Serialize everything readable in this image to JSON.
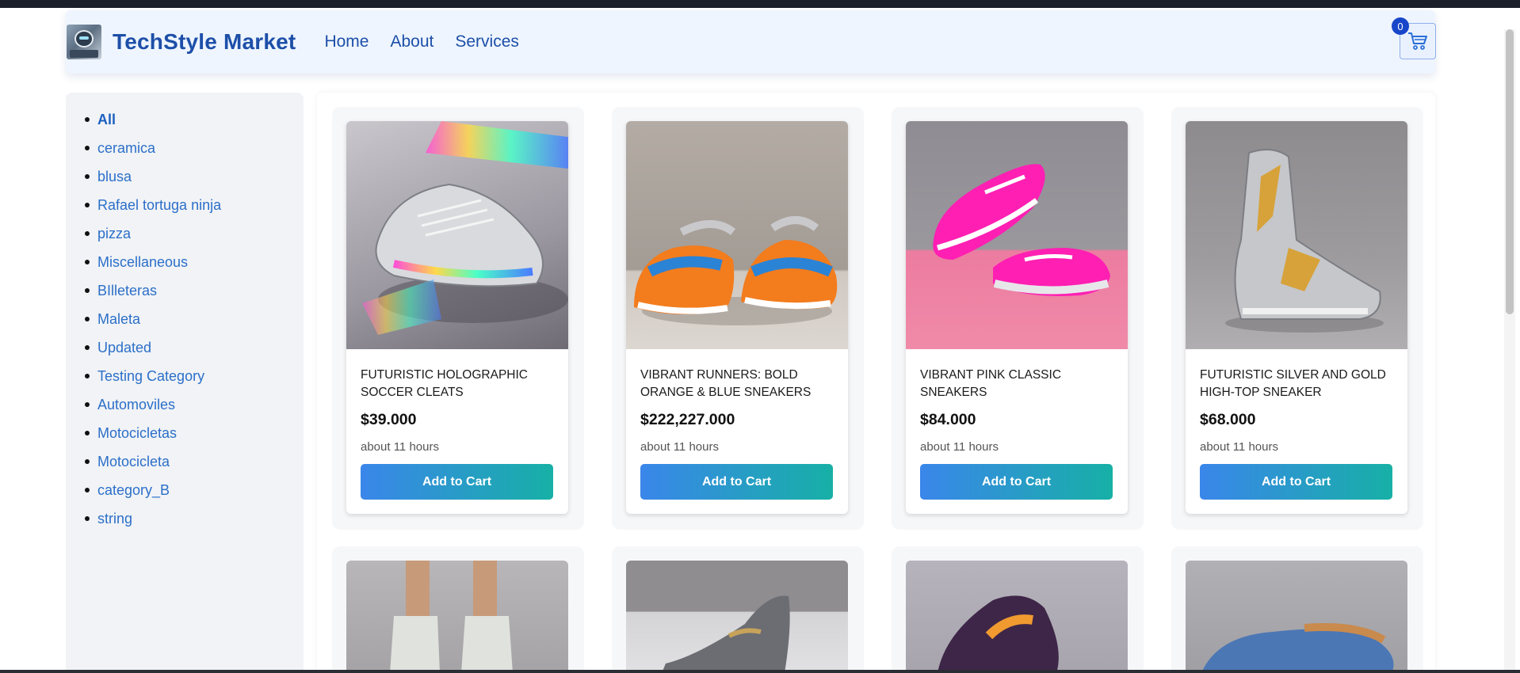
{
  "header": {
    "brand": "TechStyle Market",
    "nav": [
      "Home",
      "About",
      "Services"
    ],
    "cart_count": "0",
    "cart_icon": "shopping-cart-icon"
  },
  "sidebar": {
    "categories": [
      {
        "label": "All",
        "active": true
      },
      {
        "label": "ceramica"
      },
      {
        "label": "blusa"
      },
      {
        "label": "Rafael tortuga ninja"
      },
      {
        "label": "pizza"
      },
      {
        "label": "Miscellaneous"
      },
      {
        "label": "BIlleteras"
      },
      {
        "label": "Maleta"
      },
      {
        "label": "Updated"
      },
      {
        "label": "Testing Category"
      },
      {
        "label": "Automoviles"
      },
      {
        "label": "Motocicletas"
      },
      {
        "label": "Motocicleta"
      },
      {
        "label": "category_B"
      },
      {
        "label": "string"
      }
    ]
  },
  "products": [
    {
      "name": "FUTURISTIC HOLOGRAPHIC SOCCER CLEATS",
      "price": "$39.000",
      "time": "about 11 hours",
      "button": "Add to Cart"
    },
    {
      "name": "VIBRANT RUNNERS: BOLD ORANGE & BLUE SNEAKERS",
      "price": "$222,227.000",
      "time": "about 11 hours",
      "button": "Add to Cart"
    },
    {
      "name": "VIBRANT PINK CLASSIC SNEAKERS",
      "price": "$84.000",
      "time": "about 11 hours",
      "button": "Add to Cart"
    },
    {
      "name": "FUTURISTIC SILVER AND GOLD HIGH-TOP SNEAKER",
      "price": "$68.000",
      "time": "about 11 hours",
      "button": "Add to Cart"
    }
  ],
  "colors": {
    "accent": "#1d4fa8",
    "button_gradient_start": "#3a86ea",
    "button_gradient_end": "#17b0a6"
  }
}
